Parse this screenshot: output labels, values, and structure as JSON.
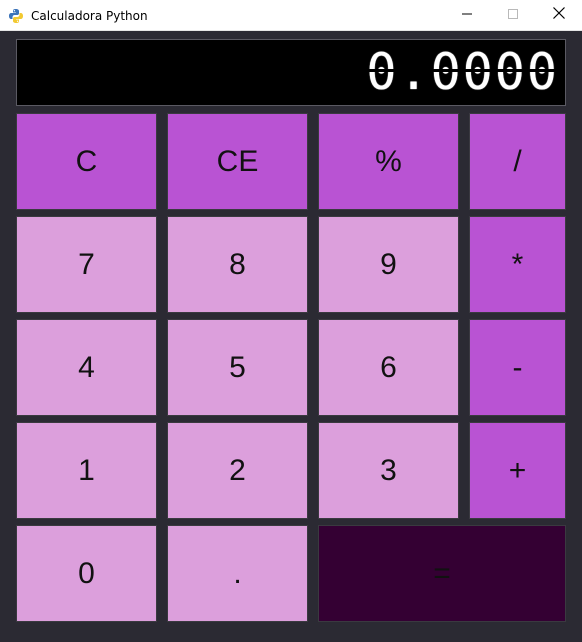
{
  "window": {
    "title": "Calculadora Python",
    "icon": "python-icon",
    "controls": [
      "minimize-icon",
      "maximize-icon",
      "close-icon"
    ]
  },
  "display": {
    "value": "0.0000"
  },
  "keys": {
    "clear": "C",
    "clear_entry": "CE",
    "percent": "%",
    "divide": "/",
    "seven": "7",
    "eight": "8",
    "nine": "9",
    "multiply": "*",
    "four": "4",
    "five": "5",
    "six": "6",
    "subtract": "-",
    "one": "1",
    "two": "2",
    "three": "3",
    "add": "+",
    "zero": "0",
    "decimal": ".",
    "equals": "="
  },
  "colors": {
    "operator_key": "#b953d3",
    "number_key": "#dc9fdc",
    "equals_key": "#340033",
    "background": "#2b2a33",
    "display_bg": "#000000",
    "display_text": "#ffffff"
  }
}
